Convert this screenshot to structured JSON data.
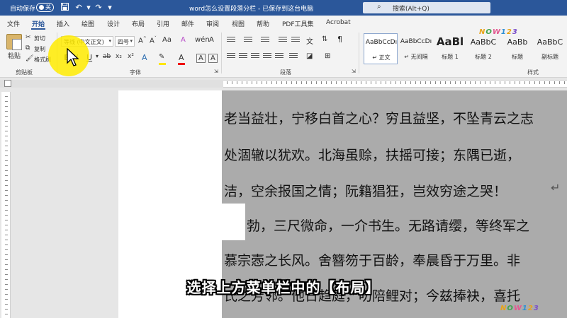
{
  "titlebar": {
    "autosave_label": "自动保存",
    "autosave_state": "关",
    "doc_title": "word怎么设置段落分栏 - 已保存到这台电脑",
    "search_placeholder": "搜索(Alt+Q)",
    "save_icon": "save-icon",
    "undo_icon": "undo-icon",
    "redo_icon": "redo-icon"
  },
  "tabs": [
    "文件",
    "开始",
    "插入",
    "绘图",
    "设计",
    "布局",
    "引用",
    "邮件",
    "审阅",
    "视图",
    "帮助",
    "PDF工具集",
    "Acrobat"
  ],
  "active_tab": "开始",
  "ribbon": {
    "clipboard": {
      "paste": "粘贴",
      "cut": "剪切",
      "copy": "复制",
      "format_painter": "格式刷",
      "group_label": "剪贴板"
    },
    "font": {
      "font_name": "等线 (中文正文)",
      "font_size": "四号",
      "group_label": "字体",
      "bold": "B",
      "italic": "I",
      "underline": "U",
      "strike": "ab",
      "sub": "x₂",
      "sup": "x²"
    },
    "paragraph": {
      "group_label": "段落"
    },
    "styles": {
      "items": [
        {
          "sample": "AaBbCcDı",
          "name": "↵ 正文"
        },
        {
          "sample": "AaBbCcDı",
          "name": "↵ 无间隔"
        },
        {
          "sample": "AaBl",
          "name": "标题 1"
        },
        {
          "sample": "AaBbC",
          "name": "标题 2"
        },
        {
          "sample": "AaBb",
          "name": "标题"
        },
        {
          "sample": "AaBbC",
          "name": "副标题"
        }
      ],
      "group_label": "样式"
    }
  },
  "document": {
    "lines": [
      "老当益壮，宁移白首之心？穷且益坚，不坠青云之志",
      "处涸辙以犹欢。北海虽赊，扶摇可接；东隅已逝，",
      "洁，空余报国之情；阮籍猖狂，岂效穷途之哭！",
      "勃，三尺微命，一介书生。无路请缨，等终军之",
      "慕宗悫之长风。舍簪笏于百龄，奉晨昏于万里。非",
      "氏之芳邻。他日趋庭，叨陪鲤对；今兹捧袂，喜托"
    ]
  },
  "subtitle": "选择上方菜单栏中的【布局】",
  "watermark": "NOW123",
  "colors": {
    "titlebar": "#2b579a",
    "highlight": "#ffeb00",
    "selection": "#ababab"
  }
}
